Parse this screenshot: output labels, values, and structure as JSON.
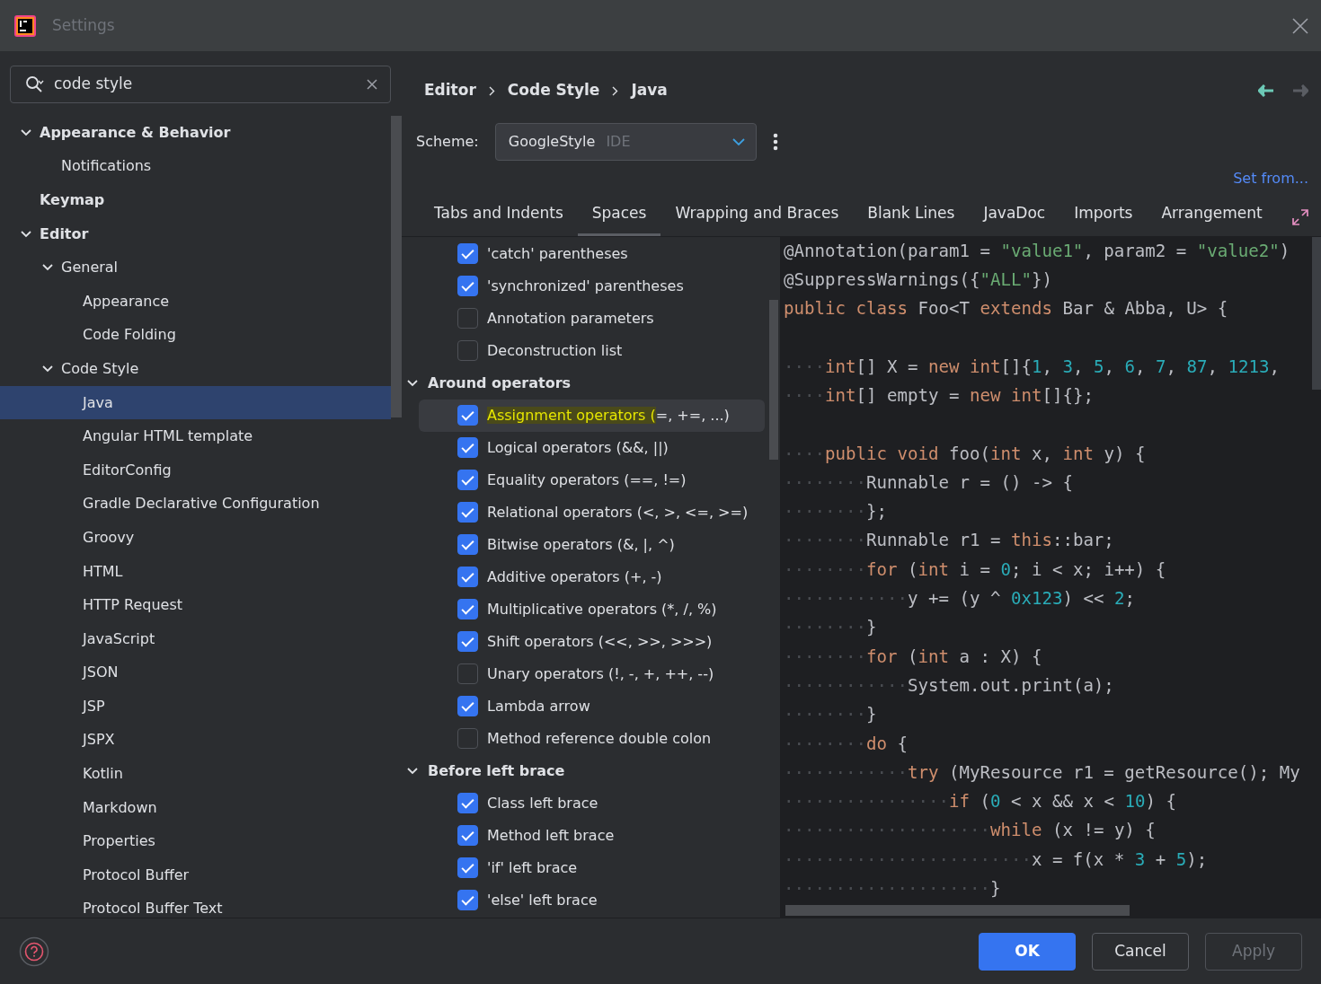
{
  "window": {
    "title": "Settings"
  },
  "search": {
    "value": "code style"
  },
  "sidebar": {
    "items": [
      {
        "label": "Appearance & Behavior",
        "expanded": true,
        "selected": false,
        "children": [
          {
            "label": "Notifications",
            "selected": false
          }
        ]
      },
      {
        "label": "Keymap",
        "selected": false
      },
      {
        "label": "Editor",
        "expanded": true,
        "selected": false,
        "children": [
          {
            "label": "General",
            "expanded": true,
            "selected": false,
            "children": [
              {
                "label": "Appearance",
                "selected": false
              },
              {
                "label": "Code Folding",
                "selected": false
              }
            ]
          },
          {
            "label": "Code Style",
            "expanded": true,
            "selected": false,
            "children": [
              {
                "label": "Java",
                "selected": true
              },
              {
                "label": "Angular HTML template",
                "selected": false
              },
              {
                "label": "EditorConfig",
                "selected": false
              },
              {
                "label": "Gradle Declarative Configuration",
                "selected": false
              },
              {
                "label": "Groovy",
                "selected": false
              },
              {
                "label": "HTML",
                "selected": false
              },
              {
                "label": "HTTP Request",
                "selected": false
              },
              {
                "label": "JavaScript",
                "selected": false
              },
              {
                "label": "JSON",
                "selected": false
              },
              {
                "label": "JSP",
                "selected": false
              },
              {
                "label": "JSPX",
                "selected": false
              },
              {
                "label": "Kotlin",
                "selected": false
              },
              {
                "label": "Markdown",
                "selected": false
              },
              {
                "label": "Properties",
                "selected": false
              },
              {
                "label": "Protocol Buffer",
                "selected": false
              },
              {
                "label": "Protocol Buffer Text",
                "selected": false
              }
            ]
          }
        ]
      }
    ]
  },
  "breadcrumb": [
    "Editor",
    "Code Style",
    "Java"
  ],
  "nav": {
    "back_disabled": false,
    "forward_disabled": true
  },
  "scheme": {
    "label": "Scheme:",
    "value": "GoogleStyle",
    "hint": "IDE"
  },
  "set_from": "Set from...",
  "tabs": [
    {
      "label": "Tabs and Indents",
      "selected": false
    },
    {
      "label": "Spaces",
      "selected": true
    },
    {
      "label": "Wrapping and Braces",
      "selected": false
    },
    {
      "label": "Blank Lines",
      "selected": false
    },
    {
      "label": "JavaDoc",
      "selected": false
    },
    {
      "label": "Imports",
      "selected": false
    },
    {
      "label": "Arrangement",
      "selected": false
    }
  ],
  "options": [
    {
      "kind": "checkbox",
      "label": "'catch' parentheses",
      "checked": true,
      "selected": false
    },
    {
      "kind": "checkbox",
      "label": "'synchronized' parentheses",
      "checked": true,
      "selected": false
    },
    {
      "kind": "checkbox",
      "label": "Annotation parameters",
      "checked": false,
      "selected": false
    },
    {
      "kind": "checkbox",
      "label": "Deconstruction list",
      "checked": false,
      "selected": false
    },
    {
      "kind": "section",
      "label": "Around operators",
      "expanded": true
    },
    {
      "kind": "checkbox",
      "match": "Assignment operators (",
      "label": "=, +=, ...)",
      "checked": true,
      "selected": true
    },
    {
      "kind": "checkbox",
      "label": "Logical operators (&&, ||)",
      "checked": true,
      "selected": false
    },
    {
      "kind": "checkbox",
      "label": "Equality operators (==, !=)",
      "checked": true,
      "selected": false
    },
    {
      "kind": "checkbox",
      "label": "Relational operators (<, >, <=, >=)",
      "checked": true,
      "selected": false
    },
    {
      "kind": "checkbox",
      "label": "Bitwise operators (&, |, ^)",
      "checked": true,
      "selected": false
    },
    {
      "kind": "checkbox",
      "label": "Additive operators (+, -)",
      "checked": true,
      "selected": false
    },
    {
      "kind": "checkbox",
      "label": "Multiplicative operators (*, /, %)",
      "checked": true,
      "selected": false
    },
    {
      "kind": "checkbox",
      "label": "Shift operators (<<, >>, >>>)",
      "checked": true,
      "selected": false
    },
    {
      "kind": "checkbox",
      "label": "Unary operators (!, -, +, ++, --)",
      "checked": false,
      "selected": false
    },
    {
      "kind": "checkbox",
      "label": "Lambda arrow",
      "checked": true,
      "selected": false
    },
    {
      "kind": "checkbox",
      "label": "Method reference double colon",
      "checked": false,
      "selected": false
    },
    {
      "kind": "section",
      "label": "Before left brace",
      "expanded": true
    },
    {
      "kind": "checkbox",
      "label": "Class left brace",
      "checked": true,
      "selected": false
    },
    {
      "kind": "checkbox",
      "label": "Method left brace",
      "checked": true,
      "selected": false
    },
    {
      "kind": "checkbox",
      "label": "'if' left brace",
      "checked": true,
      "selected": false
    },
    {
      "kind": "checkbox",
      "label": "'else' left brace",
      "checked": true,
      "selected": false
    }
  ],
  "code": [
    {
      "kind": "code",
      "tokens": [
        {
          "kind": "plain",
          "text": "@Annotation(param1 = "
        },
        {
          "kind": "string",
          "text": "\"value1\""
        },
        {
          "kind": "plain",
          "text": ", param2 = "
        },
        {
          "kind": "string",
          "text": "\"value2\""
        },
        {
          "kind": "plain",
          "text": ")"
        }
      ]
    },
    {
      "kind": "code",
      "tokens": [
        {
          "kind": "plain",
          "text": "@SuppressWarnings({"
        },
        {
          "kind": "string",
          "text": "\"ALL\""
        },
        {
          "kind": "plain",
          "text": "})"
        }
      ]
    },
    {
      "kind": "code",
      "tokens": [
        {
          "kind": "keyword",
          "text": "public class "
        },
        {
          "kind": "plain",
          "text": "Foo<T "
        },
        {
          "kind": "keyword",
          "text": "extends "
        },
        {
          "kind": "plain",
          "text": "Bar & Abba, U> {"
        }
      ]
    },
    {
      "kind": "blank"
    },
    {
      "kind": "code",
      "tokens": [
        {
          "kind": "whitespace",
          "text": "····"
        },
        {
          "kind": "keyword",
          "text": "int"
        },
        {
          "kind": "plain",
          "text": "[] X = "
        },
        {
          "kind": "keyword",
          "text": "new int"
        },
        {
          "kind": "plain",
          "text": "[]{"
        },
        {
          "kind": "number",
          "text": "1"
        },
        {
          "kind": "plain",
          "text": ", "
        },
        {
          "kind": "number",
          "text": "3"
        },
        {
          "kind": "plain",
          "text": ", "
        },
        {
          "kind": "number",
          "text": "5"
        },
        {
          "kind": "plain",
          "text": ", "
        },
        {
          "kind": "number",
          "text": "6"
        },
        {
          "kind": "plain",
          "text": ", "
        },
        {
          "kind": "number",
          "text": "7"
        },
        {
          "kind": "plain",
          "text": ", "
        },
        {
          "kind": "number",
          "text": "87"
        },
        {
          "kind": "plain",
          "text": ", "
        },
        {
          "kind": "number",
          "text": "1213"
        },
        {
          "kind": "plain",
          "text": ","
        }
      ]
    },
    {
      "kind": "code",
      "tokens": [
        {
          "kind": "whitespace",
          "text": "····"
        },
        {
          "kind": "keyword",
          "text": "int"
        },
        {
          "kind": "plain",
          "text": "[] empty = "
        },
        {
          "kind": "keyword",
          "text": "new int"
        },
        {
          "kind": "plain",
          "text": "[]{};"
        }
      ]
    },
    {
      "kind": "blank"
    },
    {
      "kind": "code",
      "tokens": [
        {
          "kind": "whitespace",
          "text": "····"
        },
        {
          "kind": "keyword",
          "text": "public void "
        },
        {
          "kind": "plain",
          "text": "foo("
        },
        {
          "kind": "keyword",
          "text": "int "
        },
        {
          "kind": "plain",
          "text": "x, "
        },
        {
          "kind": "keyword",
          "text": "int "
        },
        {
          "kind": "plain",
          "text": "y) {"
        }
      ]
    },
    {
      "kind": "code",
      "tokens": [
        {
          "kind": "whitespace",
          "text": "········"
        },
        {
          "kind": "plain",
          "text": "Runnable r = () -> {"
        }
      ]
    },
    {
      "kind": "code",
      "tokens": [
        {
          "kind": "whitespace",
          "text": "········"
        },
        {
          "kind": "plain",
          "text": "};"
        }
      ]
    },
    {
      "kind": "code",
      "tokens": [
        {
          "kind": "whitespace",
          "text": "········"
        },
        {
          "kind": "plain",
          "text": "Runnable r1 = "
        },
        {
          "kind": "keyword",
          "text": "this"
        },
        {
          "kind": "plain",
          "text": "::bar;"
        }
      ]
    },
    {
      "kind": "code",
      "tokens": [
        {
          "kind": "whitespace",
          "text": "········"
        },
        {
          "kind": "keyword",
          "text": "for "
        },
        {
          "kind": "plain",
          "text": "("
        },
        {
          "kind": "keyword",
          "text": "int "
        },
        {
          "kind": "plain",
          "text": "i = "
        },
        {
          "kind": "number",
          "text": "0"
        },
        {
          "kind": "plain",
          "text": "; i < x; i++) {"
        }
      ]
    },
    {
      "kind": "code",
      "tokens": [
        {
          "kind": "whitespace",
          "text": "············"
        },
        {
          "kind": "plain",
          "text": "y += (y ^ "
        },
        {
          "kind": "number",
          "text": "0x123"
        },
        {
          "kind": "plain",
          "text": ") << "
        },
        {
          "kind": "number",
          "text": "2"
        },
        {
          "kind": "plain",
          "text": ";"
        }
      ]
    },
    {
      "kind": "code",
      "tokens": [
        {
          "kind": "whitespace",
          "text": "········"
        },
        {
          "kind": "plain",
          "text": "}"
        }
      ]
    },
    {
      "kind": "code",
      "tokens": [
        {
          "kind": "whitespace",
          "text": "········"
        },
        {
          "kind": "keyword",
          "text": "for "
        },
        {
          "kind": "plain",
          "text": "("
        },
        {
          "kind": "keyword",
          "text": "int "
        },
        {
          "kind": "plain",
          "text": "a : X) {"
        }
      ]
    },
    {
      "kind": "code",
      "tokens": [
        {
          "kind": "whitespace",
          "text": "············"
        },
        {
          "kind": "plain",
          "text": "System.out.print(a);"
        }
      ]
    },
    {
      "kind": "code",
      "tokens": [
        {
          "kind": "whitespace",
          "text": "········"
        },
        {
          "kind": "plain",
          "text": "}"
        }
      ]
    },
    {
      "kind": "code",
      "tokens": [
        {
          "kind": "whitespace",
          "text": "········"
        },
        {
          "kind": "keyword",
          "text": "do "
        },
        {
          "kind": "plain",
          "text": "{"
        }
      ]
    },
    {
      "kind": "code",
      "tokens": [
        {
          "kind": "whitespace",
          "text": "············"
        },
        {
          "kind": "keyword",
          "text": "try "
        },
        {
          "kind": "plain",
          "text": "(MyResource r1 = getResource(); My"
        }
      ]
    },
    {
      "kind": "code",
      "tokens": [
        {
          "kind": "whitespace",
          "text": "················"
        },
        {
          "kind": "keyword",
          "text": "if "
        },
        {
          "kind": "plain",
          "text": "("
        },
        {
          "kind": "number",
          "text": "0"
        },
        {
          "kind": "plain",
          "text": " < x && x < "
        },
        {
          "kind": "number",
          "text": "10"
        },
        {
          "kind": "plain",
          "text": ") {"
        }
      ]
    },
    {
      "kind": "code",
      "tokens": [
        {
          "kind": "whitespace",
          "text": "····················"
        },
        {
          "kind": "keyword",
          "text": "while "
        },
        {
          "kind": "plain",
          "text": "(x != y) {"
        }
      ]
    },
    {
      "kind": "code",
      "tokens": [
        {
          "kind": "whitespace",
          "text": "························"
        },
        {
          "kind": "plain",
          "text": "x = f(x * "
        },
        {
          "kind": "number",
          "text": "3"
        },
        {
          "kind": "plain",
          "text": " + "
        },
        {
          "kind": "number",
          "text": "5"
        },
        {
          "kind": "plain",
          "text": ");"
        }
      ]
    },
    {
      "kind": "code",
      "tokens": [
        {
          "kind": "whitespace",
          "text": "····················"
        },
        {
          "kind": "plain",
          "text": "}"
        }
      ]
    }
  ],
  "buttons": [
    {
      "label": "OK",
      "kind": "primary",
      "disabled": false
    },
    {
      "label": "Cancel",
      "kind": "secondary",
      "disabled": false
    },
    {
      "label": "Apply",
      "kind": "secondary",
      "disabled": true
    }
  ]
}
